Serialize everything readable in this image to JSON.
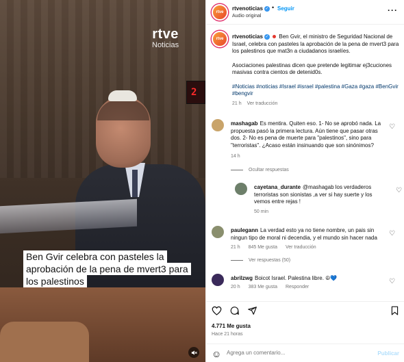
{
  "media": {
    "logo_top": "rtve",
    "logo_bottom": "Noticias",
    "sign_text": "2",
    "caption_lines": [
      "Ben Gvir celebra con pasteles la",
      "aprobación de la pena de mvert3 para",
      "los palestinos"
    ],
    "mute_icon": "speaker-muted-icon"
  },
  "header": {
    "avatar_text": "rtve",
    "username": "rtvenoticias",
    "dot": "•",
    "follow_label": "Seguir",
    "audio_label": "Audio original",
    "more_icon": "···"
  },
  "post": {
    "username": "rtvenoticias",
    "paragraph1": "Ben Gvir, el ministro de Seguridad Nacional de Israel, celebra con pasteles la aprobación de la pena de mvert3 para los palestinos que mat3n a ciudadanos israelíes.",
    "paragraph2": "Asociaciones palestinas dicen que pretende legitimar ej3cuciones masivas contra cientos de detenid0s.",
    "hashtags": "#Noticias #noticias #Israel #israel #palestina #Gaza #gaza #BenGvir #bengvir",
    "time": "21 h",
    "translate": "Ver traducción"
  },
  "comments": [
    {
      "username": "mashagab",
      "text": "Es mentira. Quiten eso. 1- No se aprobó nada. La propuesta pasó la primera lectura. Aún tiene que pasar otras dos. 2- No es pena de muerte para \"palestinos\", sino para \"terroristas\". ¿Acaso están insinuando que son sinónimos?",
      "time": "14 h",
      "replies": "Ocultar respuestas",
      "avatar_color": "#c9a46a"
    },
    {
      "username": "cayetana_durante",
      "text": "@mashagab los verdaderos terroristas son sionistas ,a ver si hay suerte y los vemos entre rejas !",
      "time": "50 min",
      "avatar_color": "#6d7f6a"
    },
    {
      "username": "paulegann",
      "text": "La verdad esto ya no tiene nombre, un pais sin ningun tipo de moral ni decendia, y el mundo sin hacer nada",
      "time": "21 h",
      "likes": "845 Me gusta",
      "translate": "Ver traducción",
      "replies": "Ver respuestas (50)",
      "avatar_color": "#8a8f6e"
    },
    {
      "username": "abrilzwg",
      "text": "Boicot Israel. Palestina libre. ☮💙",
      "time": "20 h",
      "likes": "383 Me gusta",
      "reply": "Responder",
      "avatar_color": "#3a2a5a"
    }
  ],
  "actions": {
    "likes": "4.771 Me gusta",
    "time": "Hace 21 horas",
    "comment_placeholder": "Agrega un comentario...",
    "publish_label": "Publicar"
  }
}
